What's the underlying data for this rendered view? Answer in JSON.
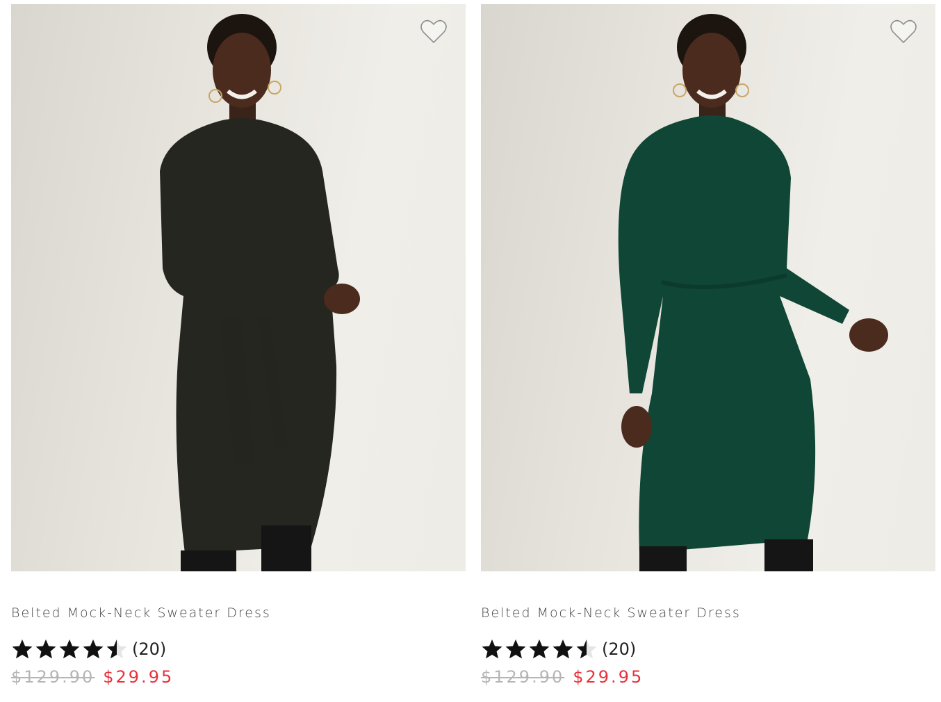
{
  "products": [
    {
      "name": "Belted Mock-Neck Sweater Dress",
      "rating": 4.5,
      "review_count": "(20)",
      "original_price": "$129.90",
      "sale_price": "$29.95",
      "dress_color": "#24261f",
      "icons": {
        "wishlist": "heart-outline-icon",
        "rating": "star-icon"
      }
    },
    {
      "name": "Belted Mock-Neck Sweater Dress",
      "rating": 4.5,
      "review_count": "(20)",
      "original_price": "$129.90",
      "sale_price": "$29.95",
      "dress_color": "#0f4636",
      "icons": {
        "wishlist": "heart-outline-icon",
        "rating": "star-icon"
      }
    }
  ],
  "colors": {
    "sale_price": "#e8313a",
    "original_price": "#b5b5b5",
    "star_filled": "#111111",
    "star_empty": "#e5e5e5"
  }
}
